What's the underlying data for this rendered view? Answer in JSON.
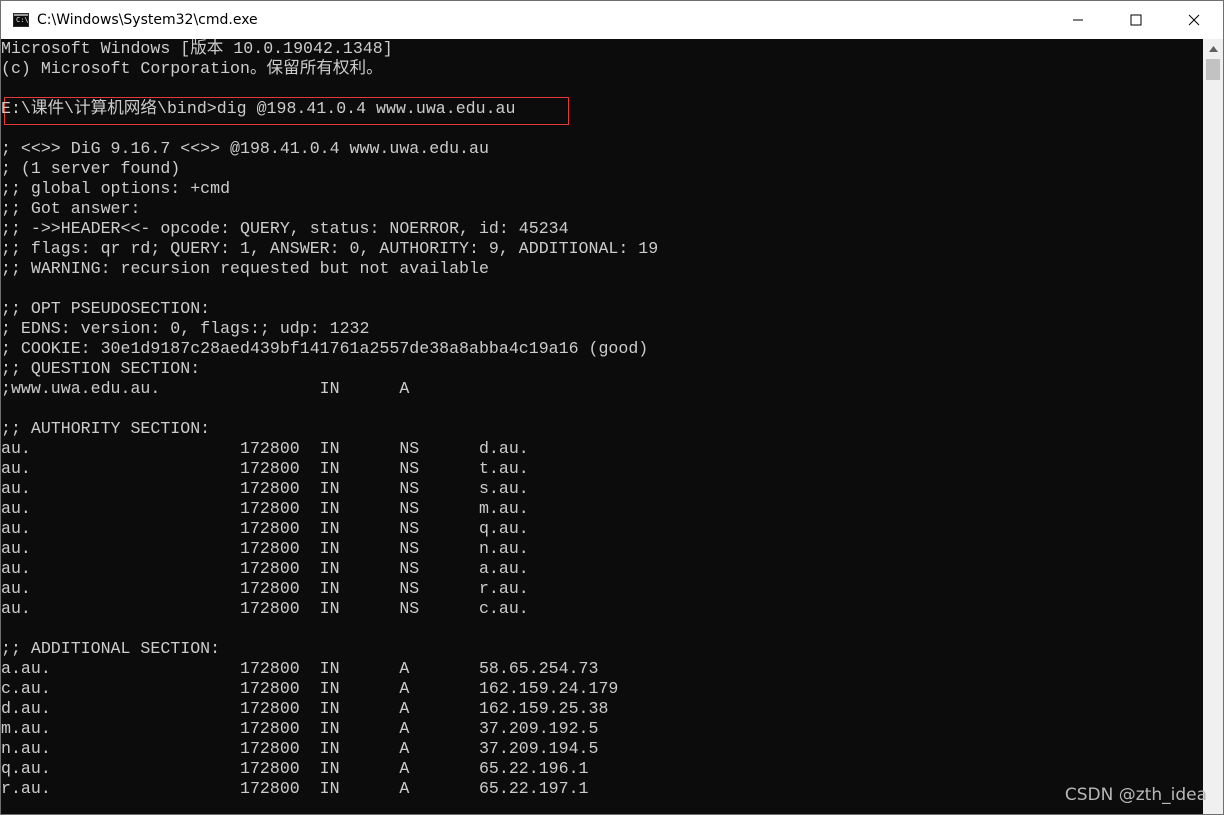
{
  "window": {
    "title": "C:\\Windows\\System32\\cmd.exe",
    "icon": "cmd-icon",
    "icon_text": "C:\\",
    "controls": [
      "minimize-icon",
      "maximize-icon",
      "close-icon"
    ]
  },
  "terminal": {
    "background": "#0c0c0c",
    "foreground": "#cccccc",
    "highlight_color": "#e53935",
    "lines": [
      "Microsoft Windows [版本 10.0.19042.1348]",
      "(c) Microsoft Corporation。保留所有权利。",
      "",
      "E:\\课件\\计算机网络\\bind>dig @198.41.0.4 www.uwa.edu.au",
      "",
      "; <<>> DiG 9.16.7 <<>> @198.41.0.4 www.uwa.edu.au",
      "; (1 server found)",
      ";; global options: +cmd",
      ";; Got answer:",
      ";; ->>HEADER<<- opcode: QUERY, status: NOERROR, id: 45234",
      ";; flags: qr rd; QUERY: 1, ANSWER: 0, AUTHORITY: 9, ADDITIONAL: 19",
      ";; WARNING: recursion requested but not available",
      "",
      ";; OPT PSEUDOSECTION:",
      "; EDNS: version: 0, flags:; udp: 1232",
      "; COOKIE: 30e1d9187c28aed439bf141761a2557de38a8abba4c19a16 (good)",
      ";; QUESTION SECTION:",
      ";www.uwa.edu.au.                IN      A",
      "",
      ";; AUTHORITY SECTION:",
      "au.                     172800  IN      NS      d.au.",
      "au.                     172800  IN      NS      t.au.",
      "au.                     172800  IN      NS      s.au.",
      "au.                     172800  IN      NS      m.au.",
      "au.                     172800  IN      NS      q.au.",
      "au.                     172800  IN      NS      n.au.",
      "au.                     172800  IN      NS      a.au.",
      "au.                     172800  IN      NS      r.au.",
      "au.                     172800  IN      NS      c.au.",
      "",
      ";; ADDITIONAL SECTION:",
      "a.au.                   172800  IN      A       58.65.254.73",
      "c.au.                   172800  IN      A       162.159.24.179",
      "d.au.                   172800  IN      A       162.159.25.38",
      "m.au.                   172800  IN      A       37.209.192.5",
      "n.au.                   172800  IN      A       37.209.194.5",
      "q.au.                   172800  IN      A       65.22.196.1",
      "r.au.                   172800  IN      A       65.22.197.1"
    ]
  },
  "watermark": "CSDN @zth_idea"
}
